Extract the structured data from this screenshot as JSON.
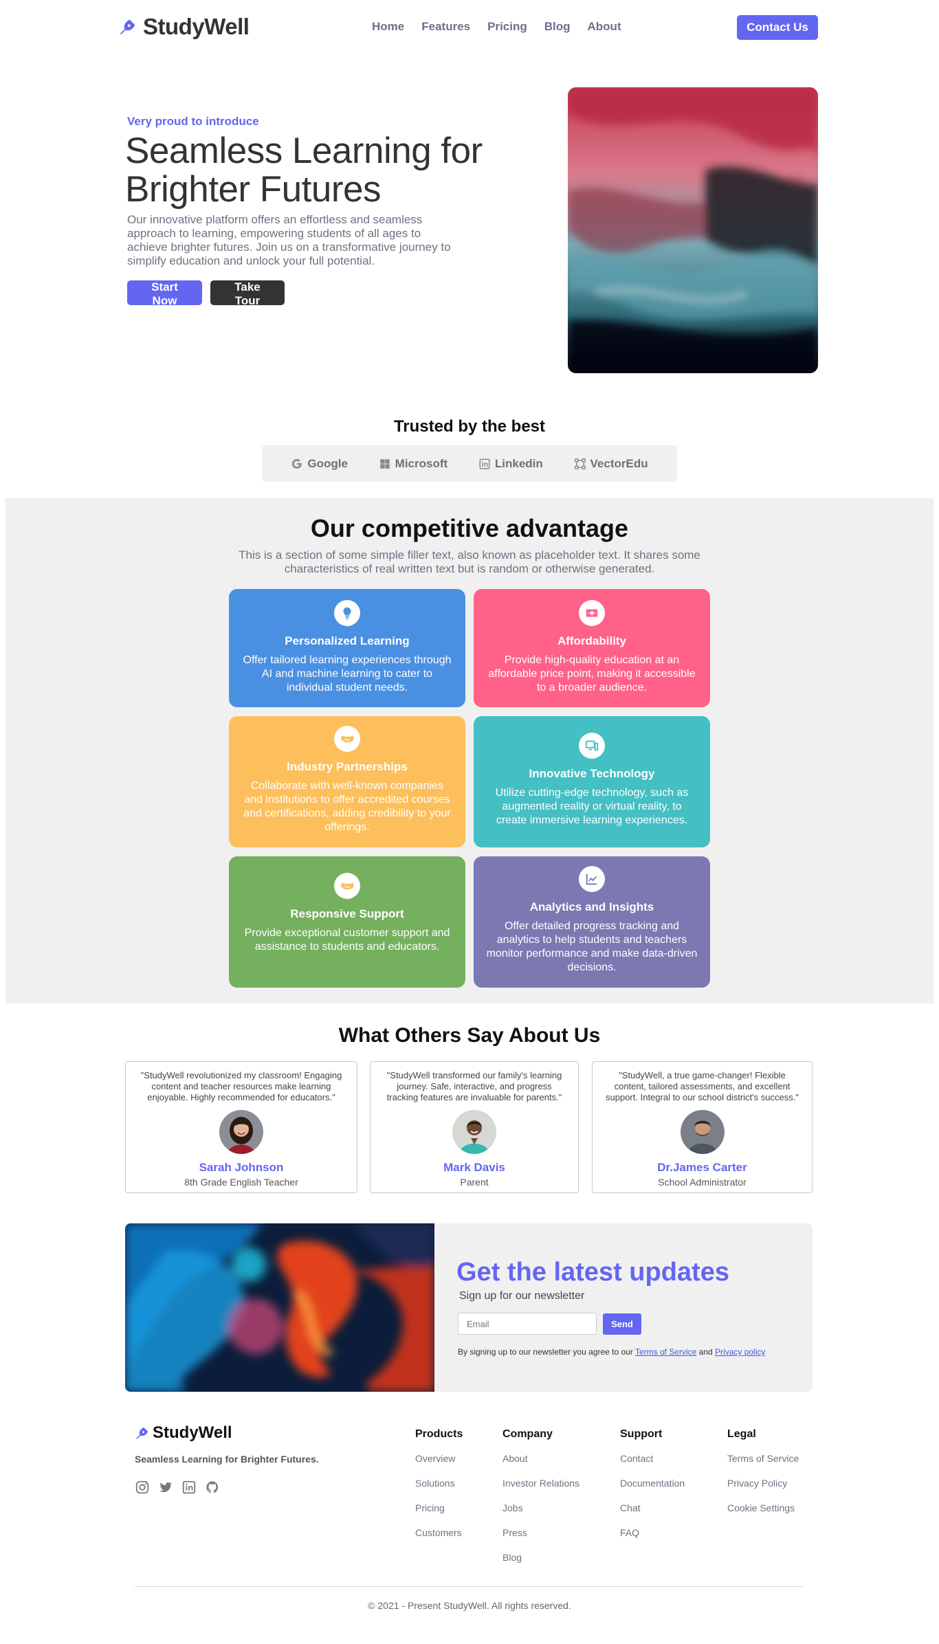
{
  "nav": {
    "logo": "StudyWell",
    "links": [
      "Home",
      "Features",
      "Pricing",
      "Blog",
      "About"
    ],
    "contact_label": "Contact Us"
  },
  "hero": {
    "intro": "Very proud to introduce",
    "title": "Seamless Learning for Brighter Futures",
    "description": "Our innovative platform offers an effortless and seamless approach to learning, empowering students of all ages to achieve brighter futures. Join us on a transformative journey to simplify education and unlock your full potential.",
    "start_label": "Start Now",
    "tour_label": "Take Tour"
  },
  "trusted": {
    "title": "Trusted by the best",
    "companies": [
      {
        "name": "Google",
        "icon": "google-icon"
      },
      {
        "name": "Microsoft",
        "icon": "microsoft-icon"
      },
      {
        "name": "Linkedin",
        "icon": "linkedin-icon"
      },
      {
        "name": "VectorEdu",
        "icon": "vector-icon"
      }
    ]
  },
  "advantage": {
    "title": "Our competitive advantage",
    "subtitle": "This is a section of some simple filler text, also known as placeholder text. It shares some characteristics of real written text but is random or otherwise generated.",
    "cards": [
      {
        "title": "Personalized Learning",
        "text": "Offer tailored learning experiences through AI and machine learning to cater to individual student needs.",
        "color": "#4a90e2",
        "icon": "lightbulb-icon"
      },
      {
        "title": "Affordability",
        "text": "Provide high-quality education at an affordable price point, making it accessible to a broader audience.",
        "color": "#ff6188",
        "icon": "money-icon"
      },
      {
        "title": "Industry Partnerships",
        "text": "Collaborate with well-known companies and institutions to offer accredited courses and certifications, adding credibility to your offerings.",
        "color": "#fcbf5c",
        "icon": "handshake-icon"
      },
      {
        "title": "Innovative Technology",
        "text": "Utilize cutting-edge technology, such as augmented reality or virtual reality, to create immersive learning experiences.",
        "color": "#44bfc4",
        "icon": "devices-icon"
      },
      {
        "title": "Responsive Support",
        "text": "Provide exceptional customer support and assistance to students and educators.",
        "color": "#74b05e",
        "icon": "handshake-icon"
      },
      {
        "title": "Analytics and Insights",
        "text": "Offer detailed progress tracking and analytics to help students and teachers monitor performance and make data-driven decisions.",
        "color": "#7c78b2",
        "icon": "chart-line-icon"
      }
    ]
  },
  "testimonials": {
    "title": "What Others Say About Us",
    "items": [
      {
        "quote": "\"StudyWell revolutionized my classroom! Engaging content and teacher resources make learning enjoyable. Highly recommended for educators.\"",
        "name": "Sarah Johnson",
        "role": "8th Grade English Teacher"
      },
      {
        "quote": "\"StudyWell transformed our family's learning journey. Safe, interactive, and progress tracking features are invaluable for parents.\"",
        "name": "Mark Davis",
        "role": "Parent"
      },
      {
        "quote": "\"StudyWell, a true game-changer! Flexible content, tailored assessments, and excellent support. Integral to our school district's success.\"",
        "name": "Dr.James Carter",
        "role": "School Administrator"
      }
    ]
  },
  "newsletter": {
    "title": "Get the latest updates",
    "subtitle": "Sign up for our newsletter",
    "email_placeholder": "Email",
    "send_label": "Send",
    "legal_prefix": "By signing up to our newsletter you agree to our",
    "terms": "Terms of Service",
    "and": "and",
    "privacy": "Privacy policy"
  },
  "footer": {
    "logo": "StudyWell",
    "tagline": "Seamless Learning for Brighter Futures.",
    "columns": [
      {
        "title": "Products",
        "links": [
          "Overview",
          "Solutions",
          "Pricing",
          "Customers"
        ]
      },
      {
        "title": "Company",
        "links": [
          "About",
          "Investor Relations",
          "Jobs",
          "Press",
          "Blog"
        ]
      },
      {
        "title": "Support",
        "links": [
          "Contact",
          "Documentation",
          "Chat",
          "FAQ"
        ]
      },
      {
        "title": "Legal",
        "links": [
          "Terms of Service",
          "Privacy Policy",
          "Cookie Settings"
        ]
      }
    ],
    "copyright": "© 2021 - Present StudyWell. All rights reserved."
  },
  "colors": {
    "primary": "#6366f1",
    "dark": "#333333"
  }
}
